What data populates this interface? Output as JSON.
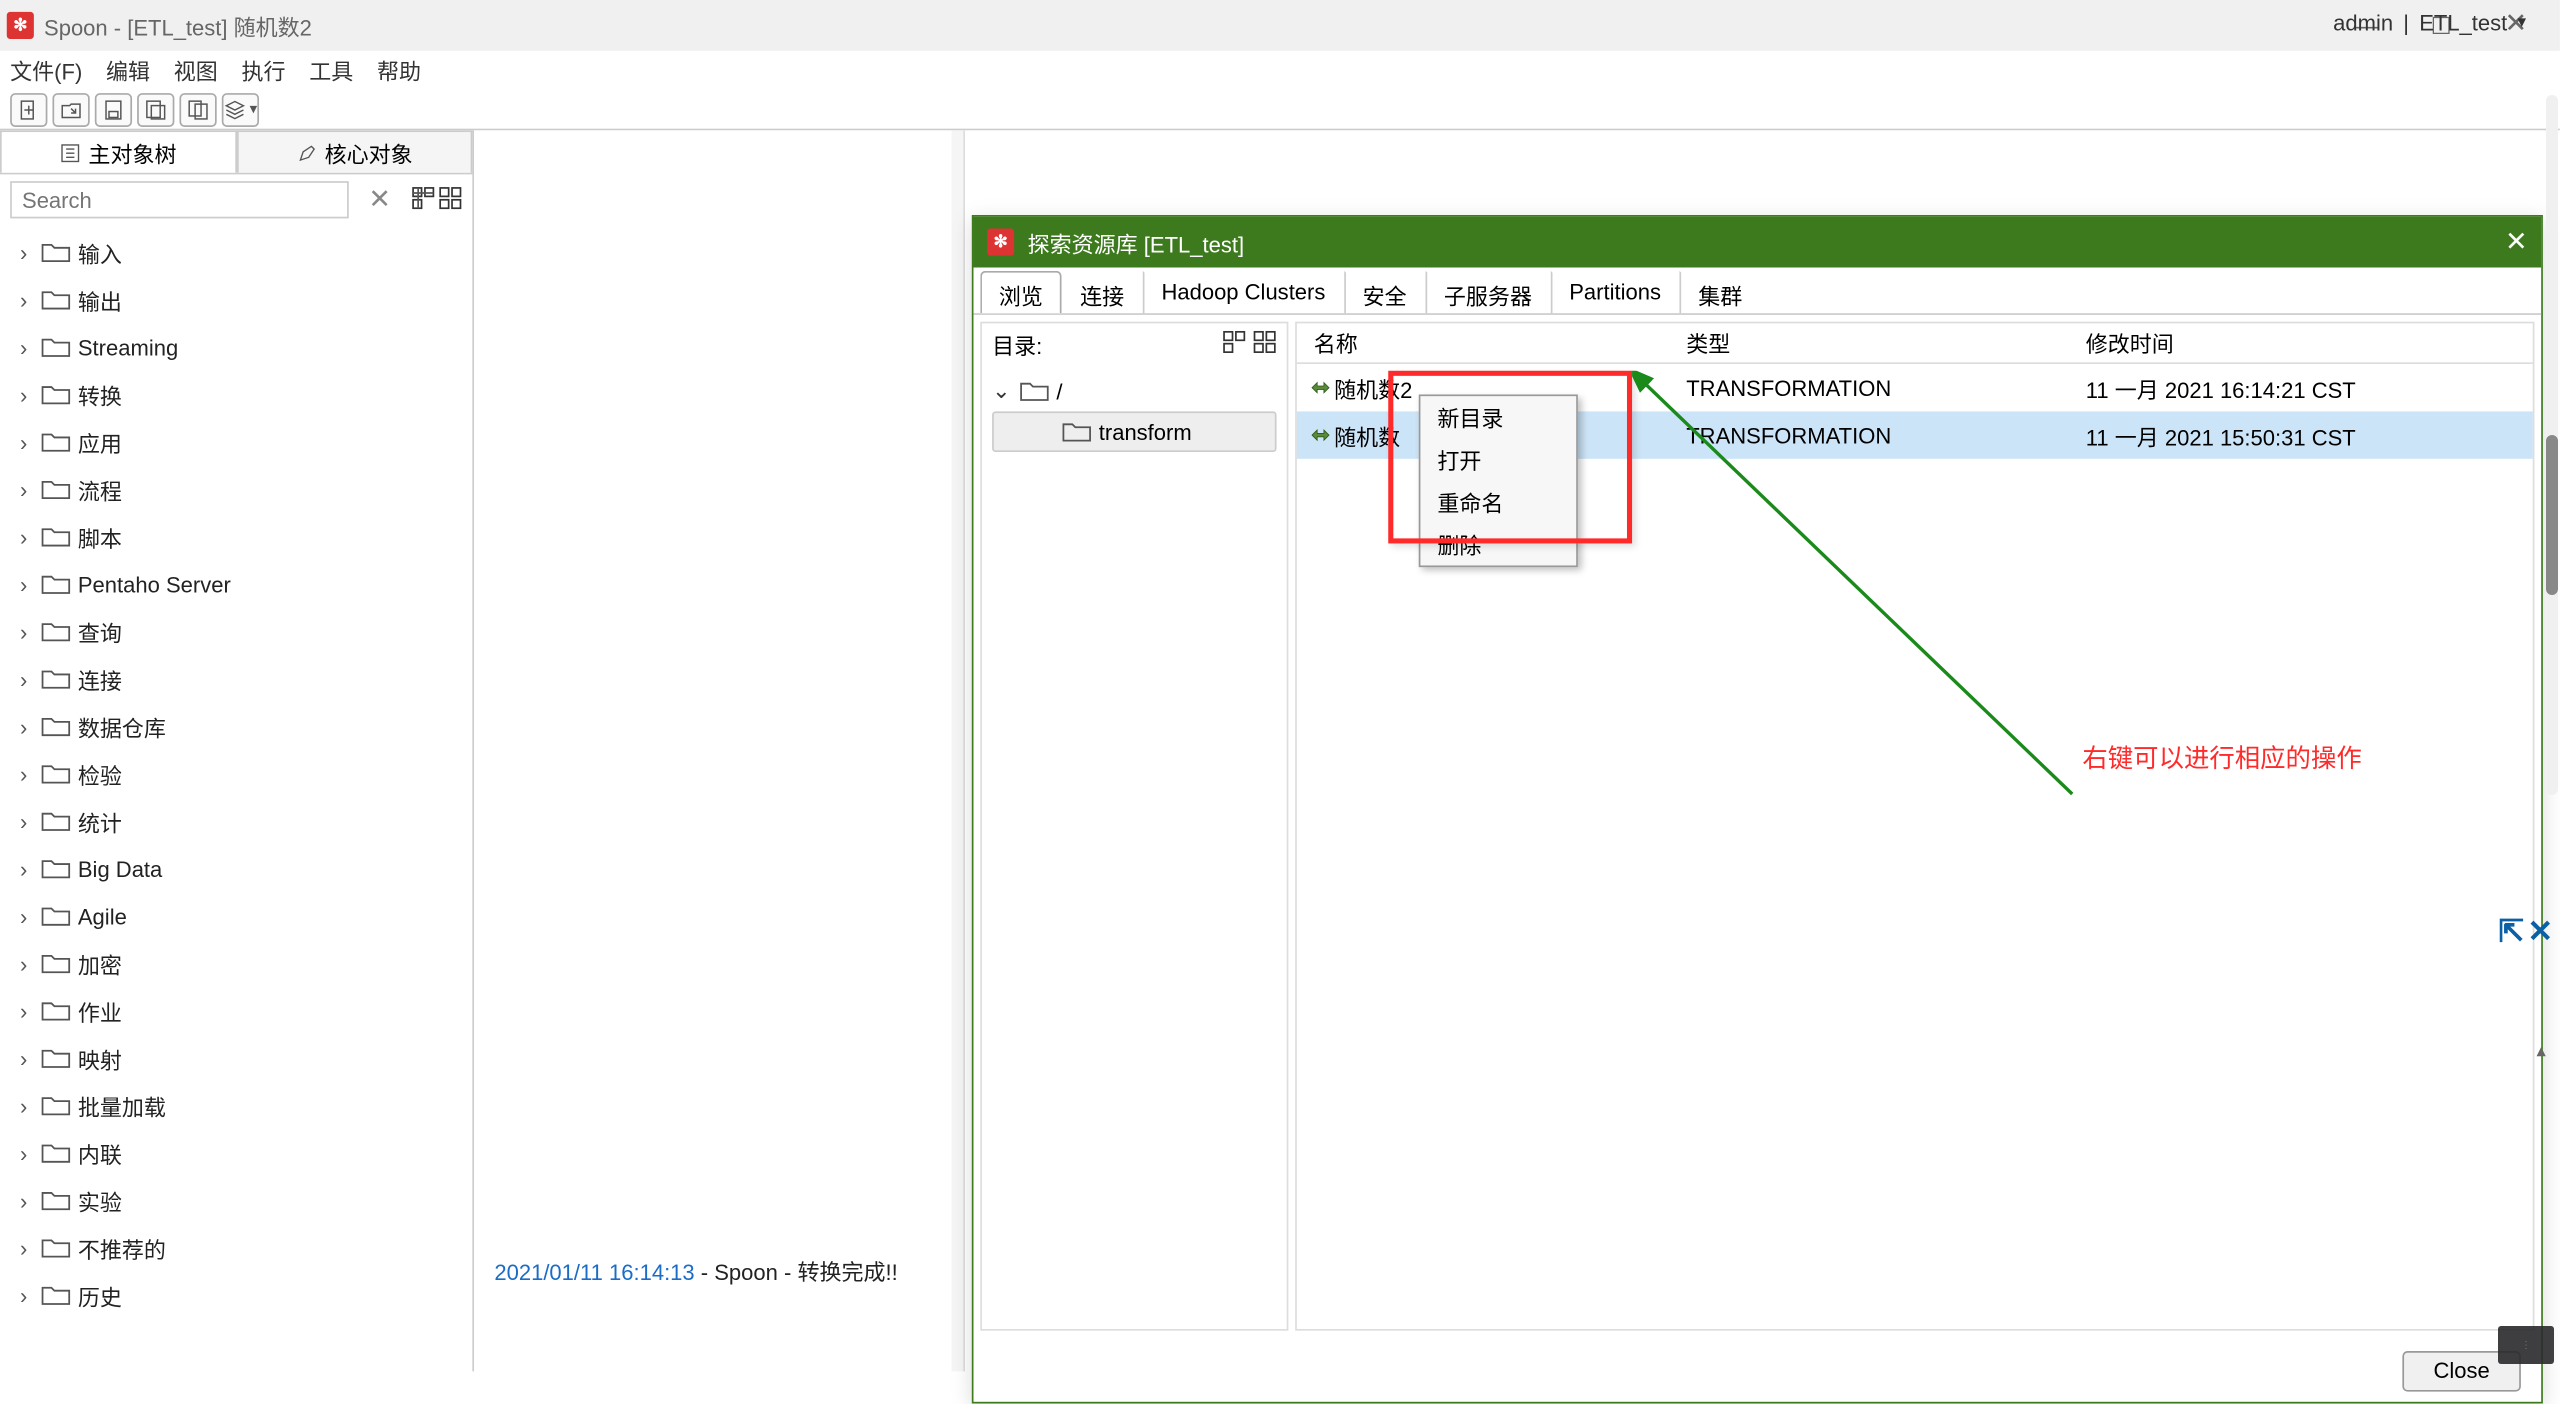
{
  "window": {
    "title": "Spoon - [ETL_test] 随机数2",
    "min": "—",
    "max": "☐",
    "close": "✕"
  },
  "menu": [
    "文件(F)",
    "编辑",
    "视图",
    "执行",
    "工具",
    "帮助"
  ],
  "repo_right": {
    "user": "admin",
    "sep": "|",
    "repo": "ETL_test"
  },
  "left_tabs": {
    "t1": "主对象树",
    "t2": "核心对象"
  },
  "search": {
    "placeholder": "Search"
  },
  "tree": [
    "输入",
    "输出",
    "Streaming",
    "转换",
    "应用",
    "流程",
    "脚本",
    "Pentaho Server",
    "查询",
    "连接",
    "数据仓库",
    "检验",
    "统计",
    "Big Data",
    "Agile",
    "加密",
    "作业",
    "映射",
    "批量加载",
    "内联",
    "实验",
    "不推荐的",
    "历史"
  ],
  "dialog": {
    "title": "探索资源库  [ETL_test]",
    "tabs": [
      "浏览",
      "连接",
      "Hadoop Clusters",
      "安全",
      "子服务器",
      "Partitions",
      "集群"
    ],
    "dir_label": "目录:",
    "dir_root": "/",
    "dir_child": "transform",
    "list": {
      "cols": {
        "name": "名称",
        "type": "类型",
        "time": "修改时间"
      },
      "rows": [
        {
          "name": "随机数2",
          "type": "TRANSFORMATION",
          "time": "11 一月 2021 16:14:21 CST",
          "sel": false
        },
        {
          "name": "随机数",
          "type": "TRANSFORMATION",
          "time": "11 一月 2021 15:50:31 CST",
          "sel": true
        }
      ]
    },
    "ctx": [
      "新目录",
      "打开",
      "重命名",
      "删除"
    ],
    "annot": "右键可以进行相应的操作",
    "close_btn": "Close"
  },
  "log": {
    "ts": "2021/01/11 16:14:13",
    "rest": " - Spoon - 转换完成!!"
  }
}
